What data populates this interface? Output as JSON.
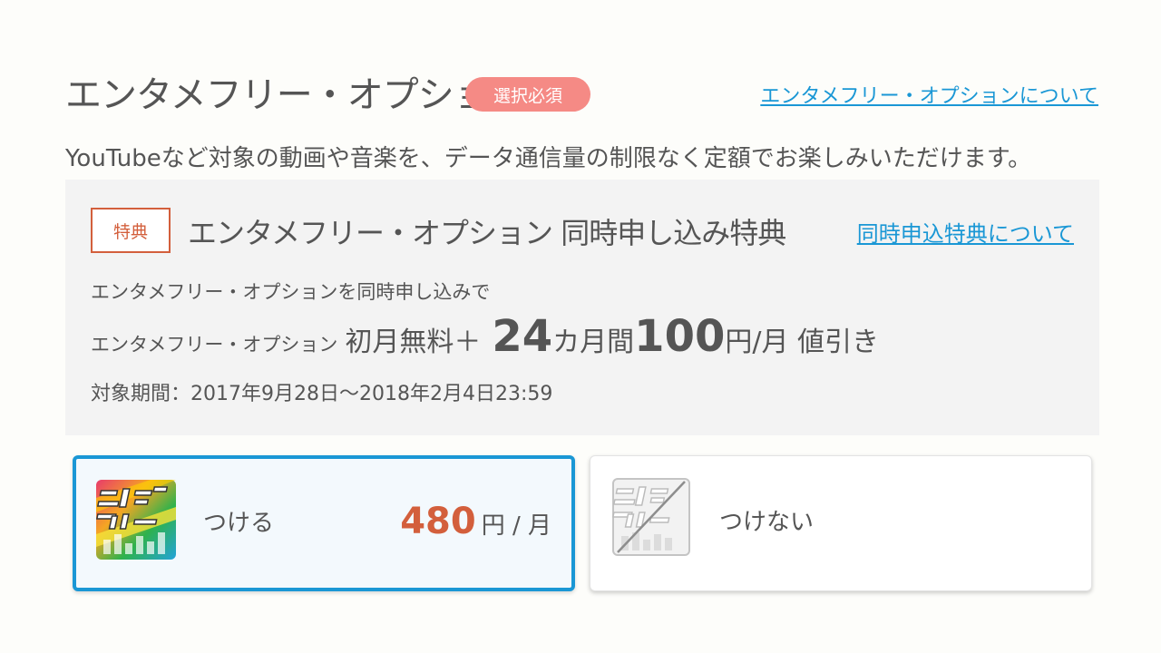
{
  "header": {
    "title": "エンタメフリー・オプション",
    "badge": "選択必須",
    "link": "エンタメフリー・オプションについて"
  },
  "description": "YouTubeなど対象の動画や音楽を、データ通信量の制限なく定額でお楽しみいただけます。",
  "benefit": {
    "tag": "特典",
    "title": "エンタメフリー・オプション 同時申し込み特典",
    "link": "同時申込特典について",
    "line1": "エンタメフリー・オプションを同時申し込みで",
    "line2": {
      "prefix": "エンタメフリー・オプション",
      "free": "初月無料＋",
      "months_num": "24",
      "months_unit": "カ月間",
      "discount_num": "100",
      "discount_unit": "円/月 値引き"
    },
    "period": "対象期間：2017年9月28日～2018年2月4日23:59"
  },
  "options": [
    {
      "label": "つける",
      "price": "480",
      "price_unit": "円 / 月",
      "selected": true,
      "logo": "entame-free-logo-icon"
    },
    {
      "label": "つけない",
      "selected": false,
      "logo": "entame-free-disabled-logo-icon"
    }
  ],
  "colors": {
    "accent": "#1a97d5",
    "badge": "#f58a85",
    "tag": "#d35f3c",
    "price": "#d35f3c",
    "benefit_bg": "#f3f3f3"
  }
}
